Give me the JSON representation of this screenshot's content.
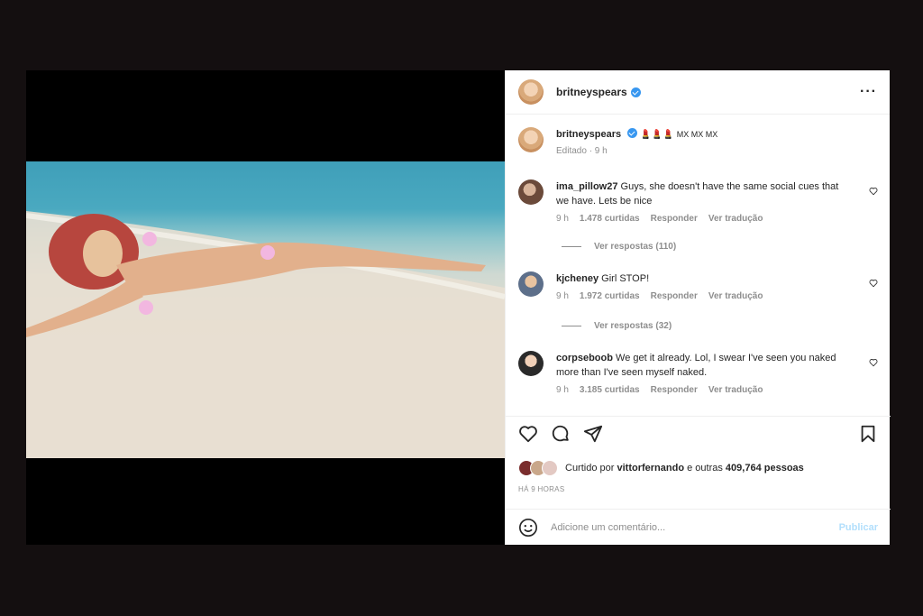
{
  "post": {
    "username": "britneyspears",
    "caption_emoji": "💄💄💄",
    "caption_text": "MX MX MX",
    "edited_label": "Editado · 9 h",
    "more_icon": "more-horizontal-icon"
  },
  "comments": [
    {
      "username": "ima_pillow27",
      "text": "Guys, she doesn't have the same social cues that we have. Lets be nice",
      "time": "9 h",
      "likes": "1.478 curtidas",
      "reply": "Responder",
      "translate": "Ver tradução",
      "view_replies": "Ver respostas (110)"
    },
    {
      "username": "kjcheney",
      "text": "Girl STOP!",
      "time": "9 h",
      "likes": "1.972 curtidas",
      "reply": "Responder",
      "translate": "Ver tradução",
      "view_replies": "Ver respostas (32)"
    },
    {
      "username": "corpseboob",
      "text": "We get it already. Lol, I swear I've seen you naked more than I've seen myself naked.",
      "time": "9 h",
      "likes": "3.185 curtidas",
      "reply": "Responder",
      "translate": "Ver tradução"
    }
  ],
  "likes": {
    "prefix": "Curtido por",
    "user": "vittorfernando",
    "middle": "e outras",
    "count": "409,764 pessoas"
  },
  "timestamp": "HÁ 9 HORAS",
  "add_comment": {
    "placeholder": "Adicione um comentário...",
    "publish": "Publicar"
  },
  "colors": {
    "verified": "#3897f0",
    "publish_disabled": "#b2dffc",
    "meta_gray": "#8e8e8e",
    "page_background": "#140f10"
  }
}
